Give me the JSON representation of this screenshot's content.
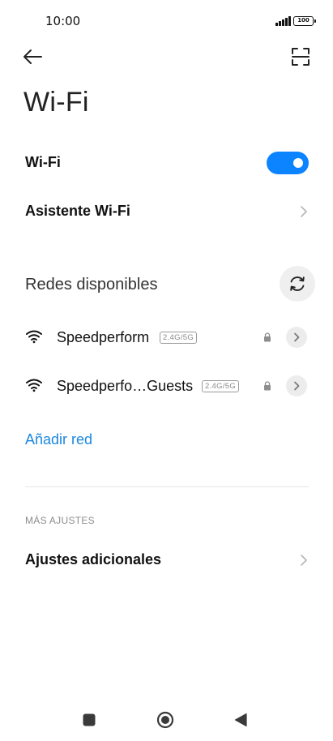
{
  "status_bar": {
    "time": "10:00",
    "battery": "100"
  },
  "header": {
    "back_icon": "arrow-left-icon",
    "scan_icon": "qr-scan-icon"
  },
  "page": {
    "title": "Wi-Fi"
  },
  "wifi_toggle": {
    "label": "Wi-Fi",
    "enabled": true,
    "accent_color": "#0d84ff"
  },
  "assistant": {
    "label": "Asistente Wi-Fi"
  },
  "available_networks": {
    "title": "Redes disponibles",
    "networks": [
      {
        "name": "Speedperform",
        "band": "2.4G/5G",
        "secured": true
      },
      {
        "name": "Speedperfo…Guests",
        "band": "2.4G/5G",
        "secured": true
      }
    ]
  },
  "add_network": {
    "label": "Añadir red",
    "color": "#1b87e0"
  },
  "more_settings": {
    "section_title": "MÁS AJUSTES",
    "additional_label": "Ajustes adicionales"
  },
  "nav_bar": {
    "recents_icon": "square-icon",
    "home_icon": "circle-icon",
    "back_icon": "triangle-back-icon"
  }
}
